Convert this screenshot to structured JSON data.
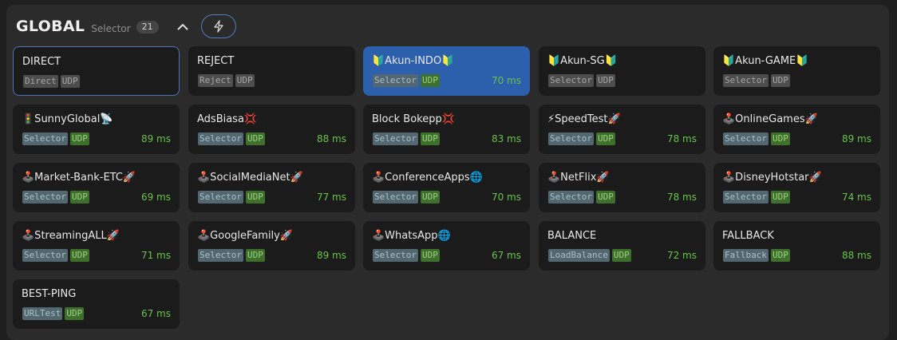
{
  "header": {
    "title": "GLOBAL",
    "subtitle": "Selector",
    "count": "21"
  },
  "proxies": [
    {
      "name": "DIRECT",
      "type": "Direct",
      "udp": "UDP",
      "delay": "",
      "state": "outlined",
      "plain": true
    },
    {
      "name": "REJECT",
      "type": "Reject",
      "udp": "UDP",
      "delay": "",
      "state": "",
      "plain": true
    },
    {
      "name": "🔰Akun-INDO🔰",
      "type": "Selector",
      "udp": "UDP",
      "delay": "70 ms",
      "state": "active",
      "plain": false
    },
    {
      "name": "🔰Akun-SG🔰",
      "type": "Selector",
      "udp": "UDP",
      "delay": "",
      "state": "",
      "plain": true
    },
    {
      "name": "🔰Akun-GAME🔰",
      "type": "Selector",
      "udp": "UDP",
      "delay": "",
      "state": "",
      "plain": true
    },
    {
      "name": "🚦SunnyGlobal📡",
      "type": "Selector",
      "udp": "UDP",
      "delay": "89 ms",
      "state": "",
      "plain": false
    },
    {
      "name": "AdsBiasa💢",
      "type": "Selector",
      "udp": "UDP",
      "delay": "88 ms",
      "state": "",
      "plain": false
    },
    {
      "name": "Block Bokepp💢",
      "type": "Selector",
      "udp": "UDP",
      "delay": "83 ms",
      "state": "",
      "plain": false
    },
    {
      "name": "⚡SpeedTest🚀",
      "type": "Selector",
      "udp": "UDP",
      "delay": "78 ms",
      "state": "",
      "plain": false
    },
    {
      "name": "🕹️OnlineGames🚀",
      "type": "Selector",
      "udp": "UDP",
      "delay": "89 ms",
      "state": "",
      "plain": false
    },
    {
      "name": "🕹️Market-Bank-ETC🚀",
      "type": "Selector",
      "udp": "UDP",
      "delay": "69 ms",
      "state": "",
      "plain": false
    },
    {
      "name": "🕹️SocialMediaNet🚀",
      "type": "Selector",
      "udp": "UDP",
      "delay": "77 ms",
      "state": "",
      "plain": false
    },
    {
      "name": "🕹️ConferenceApps🌐",
      "type": "Selector",
      "udp": "UDP",
      "delay": "70 ms",
      "state": "",
      "plain": false
    },
    {
      "name": "🕹️NetFlix🚀",
      "type": "Selector",
      "udp": "UDP",
      "delay": "78 ms",
      "state": "",
      "plain": false
    },
    {
      "name": "🕹️DisneyHotstar🚀",
      "type": "Selector",
      "udp": "UDP",
      "delay": "74 ms",
      "state": "",
      "plain": false
    },
    {
      "name": "🕹️StreamingALL🚀",
      "type": "Selector",
      "udp": "UDP",
      "delay": "71 ms",
      "state": "",
      "plain": false
    },
    {
      "name": "🕹️GoogleFamily🚀",
      "type": "Selector",
      "udp": "UDP",
      "delay": "89 ms",
      "state": "",
      "plain": false
    },
    {
      "name": "🕹️WhatsApp🌐",
      "type": "Selector",
      "udp": "UDP",
      "delay": "67 ms",
      "state": "",
      "plain": false
    },
    {
      "name": "BALANCE",
      "type": "LoadBalance",
      "udp": "UDP",
      "delay": "72 ms",
      "state": "",
      "plain": false
    },
    {
      "name": "FALLBACK",
      "type": "Fallback",
      "udp": "UDP",
      "delay": "88 ms",
      "state": "",
      "plain": false
    },
    {
      "name": "BEST-PING",
      "type": "URLTest",
      "udp": "UDP",
      "delay": "67 ms",
      "state": "",
      "plain": false
    }
  ],
  "colors": {
    "accent": "#2c5fac",
    "outline": "#4a73b8",
    "delay": "#69c24a"
  }
}
